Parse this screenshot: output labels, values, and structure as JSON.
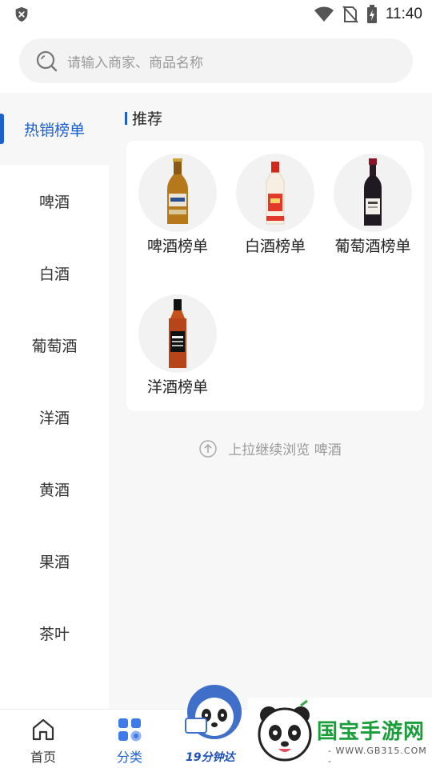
{
  "status_bar": {
    "time": "11:40"
  },
  "search": {
    "placeholder": "请输入商家、商品名称"
  },
  "sidebar": {
    "items": [
      {
        "label": "热销榜单",
        "active": true
      },
      {
        "label": "啤酒"
      },
      {
        "label": "白酒"
      },
      {
        "label": "葡萄酒"
      },
      {
        "label": "洋酒"
      },
      {
        "label": "黄酒"
      },
      {
        "label": "果酒"
      },
      {
        "label": "茶叶"
      }
    ]
  },
  "main": {
    "section_title": "推荐",
    "items": [
      {
        "label": "啤酒榜单",
        "icon": "beer-bottle-icon"
      },
      {
        "label": "白酒榜单",
        "icon": "baijiu-bottle-icon"
      },
      {
        "label": "葡萄酒榜单",
        "icon": "wine-bottle-icon"
      },
      {
        "label": "洋酒榜单",
        "icon": "whiskey-bottle-icon"
      }
    ],
    "more_hint": "上拉继续浏览 啤酒"
  },
  "bottom_nav": {
    "items": [
      {
        "label": "首页",
        "icon": "home-icon"
      },
      {
        "label": "分类",
        "icon": "category-icon",
        "active": true
      }
    ],
    "promo_text": "19分钟达"
  },
  "watermark": {
    "title": "国宝手游网",
    "url": "- WWW.GB315.COM -"
  },
  "colors": {
    "accent": "#1d5fd0",
    "background": "#f7f7f8",
    "text": "#222222",
    "muted": "#9a9a9a"
  }
}
